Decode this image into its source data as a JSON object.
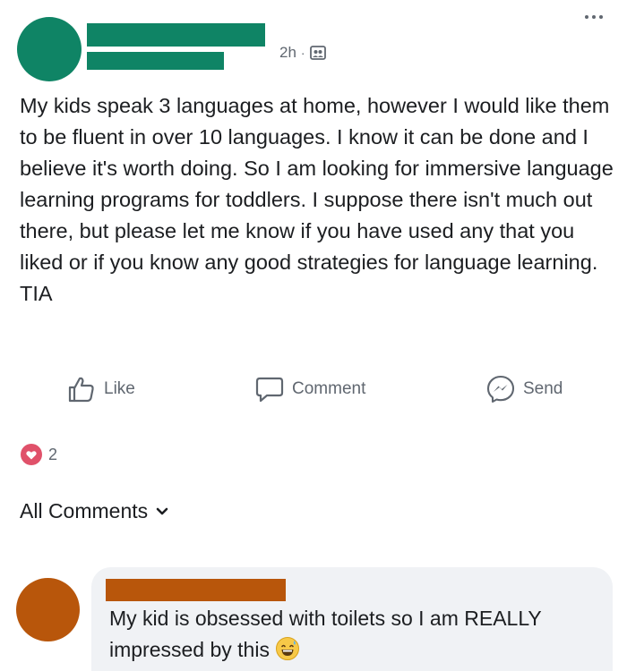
{
  "colors": {
    "author_avatar": "#0f8465",
    "redaction_author": "#0f8465",
    "commenter_avatar": "#b8560b",
    "redaction_commenter": "#b8560b",
    "muted_text": "#606770",
    "reaction_heart": "#e0516a",
    "bubble_bg": "#f0f2f5"
  },
  "post": {
    "time": "2h",
    "separator": "·",
    "privacy_icon": "friends-icon",
    "body": "My kids speak 3 languages at home, however I would like them to be fluent in over 10 languages. I know it can be done and I believe it's worth doing. So I am looking for immersive language learning programs for toddlers. I suppose there isn't much out there, but please let me know if you have used any that you liked or if you know any good strategies for language learning. TIA"
  },
  "actions": {
    "like_label": "Like",
    "comment_label": "Comment",
    "send_label": "Send"
  },
  "reactions": {
    "icon": "love-reaction-icon",
    "count": "2"
  },
  "comments": {
    "filter_label": "All Comments",
    "items": [
      {
        "text": "My kid is obsessed with toilets so I am REALLY impressed by this",
        "emoji": "grinning-sweat-emoji-icon"
      }
    ]
  }
}
